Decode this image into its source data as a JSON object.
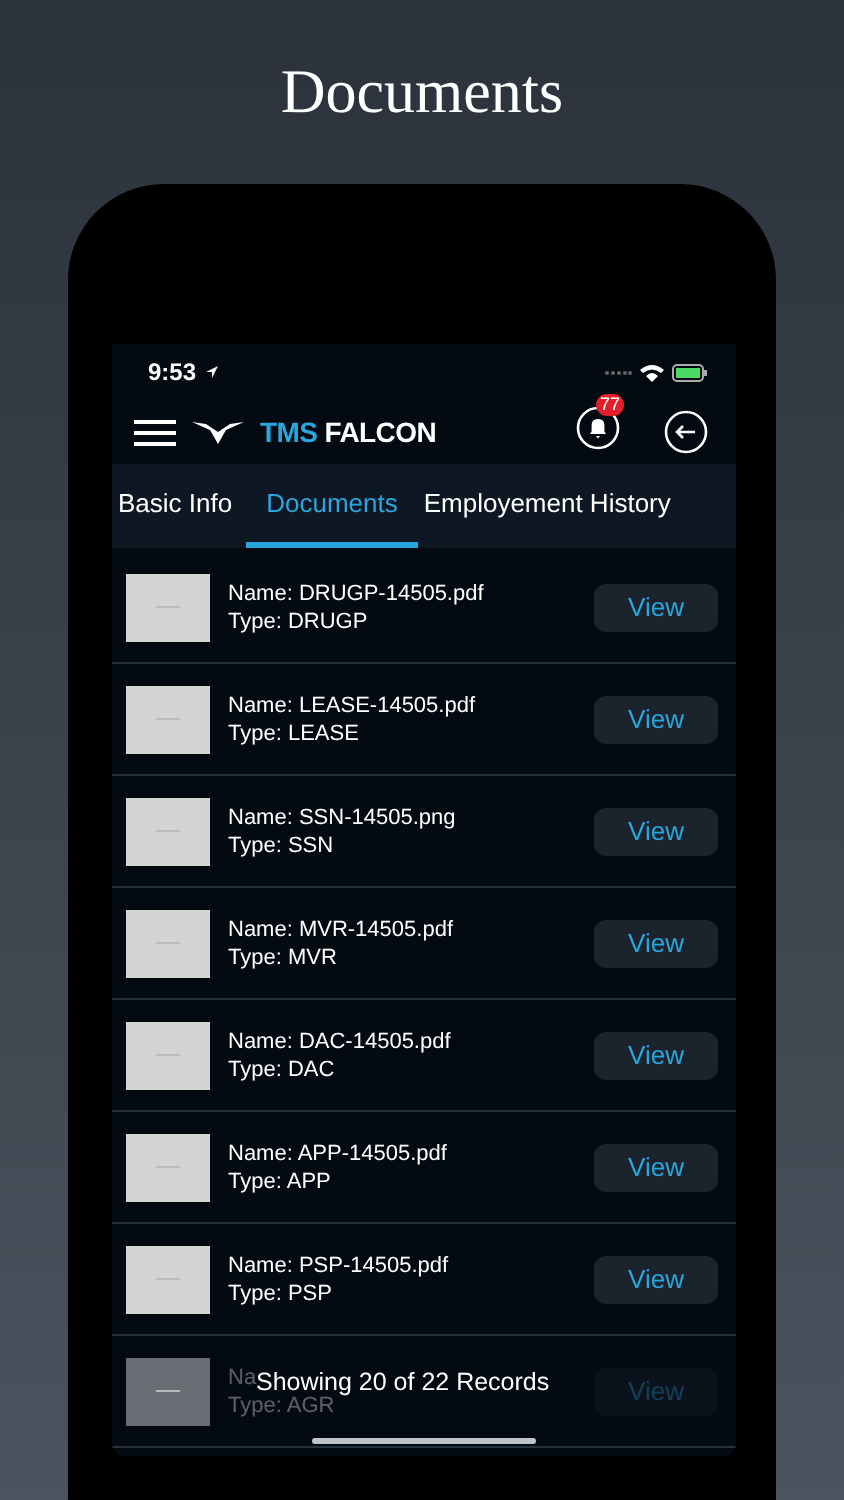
{
  "headline": "Documents",
  "status_bar": {
    "time": "9:53"
  },
  "header": {
    "logo_part_1": "TMS",
    "logo_part_2": "FALCON",
    "notification_count": "77"
  },
  "tabs": [
    {
      "label": "Basic Info",
      "selected": false
    },
    {
      "label": "Documents",
      "selected": true
    },
    {
      "label": "Employement History",
      "selected": false
    }
  ],
  "documents": [
    {
      "name_label": "Name:",
      "name": "DRUGP-14505.pdf",
      "type_label": "Type:",
      "type": "DRUGP",
      "button": "View",
      "dimmed": false
    },
    {
      "name_label": "Name:",
      "name": "LEASE-14505.pdf",
      "type_label": "Type:",
      "type": "LEASE",
      "button": "View",
      "dimmed": false
    },
    {
      "name_label": "Name:",
      "name": "SSN-14505.png",
      "type_label": "Type:",
      "type": "SSN",
      "button": "View",
      "dimmed": false
    },
    {
      "name_label": "Name:",
      "name": "MVR-14505.pdf",
      "type_label": "Type:",
      "type": "MVR",
      "button": "View",
      "dimmed": false
    },
    {
      "name_label": "Name:",
      "name": "DAC-14505.pdf",
      "type_label": "Type:",
      "type": "DAC",
      "button": "View",
      "dimmed": false
    },
    {
      "name_label": "Name:",
      "name": "APP-14505.pdf",
      "type_label": "Type:",
      "type": "APP",
      "button": "View",
      "dimmed": false
    },
    {
      "name_label": "Name:",
      "name": "PSP-14505.pdf",
      "type_label": "Type:",
      "type": "PSP",
      "button": "View",
      "dimmed": false
    },
    {
      "name_label": "Na",
      "type_label": "Type:",
      "type": "AGR",
      "button": "View",
      "dimmed": true
    }
  ],
  "toast": "Showing 20 of 22 Records"
}
